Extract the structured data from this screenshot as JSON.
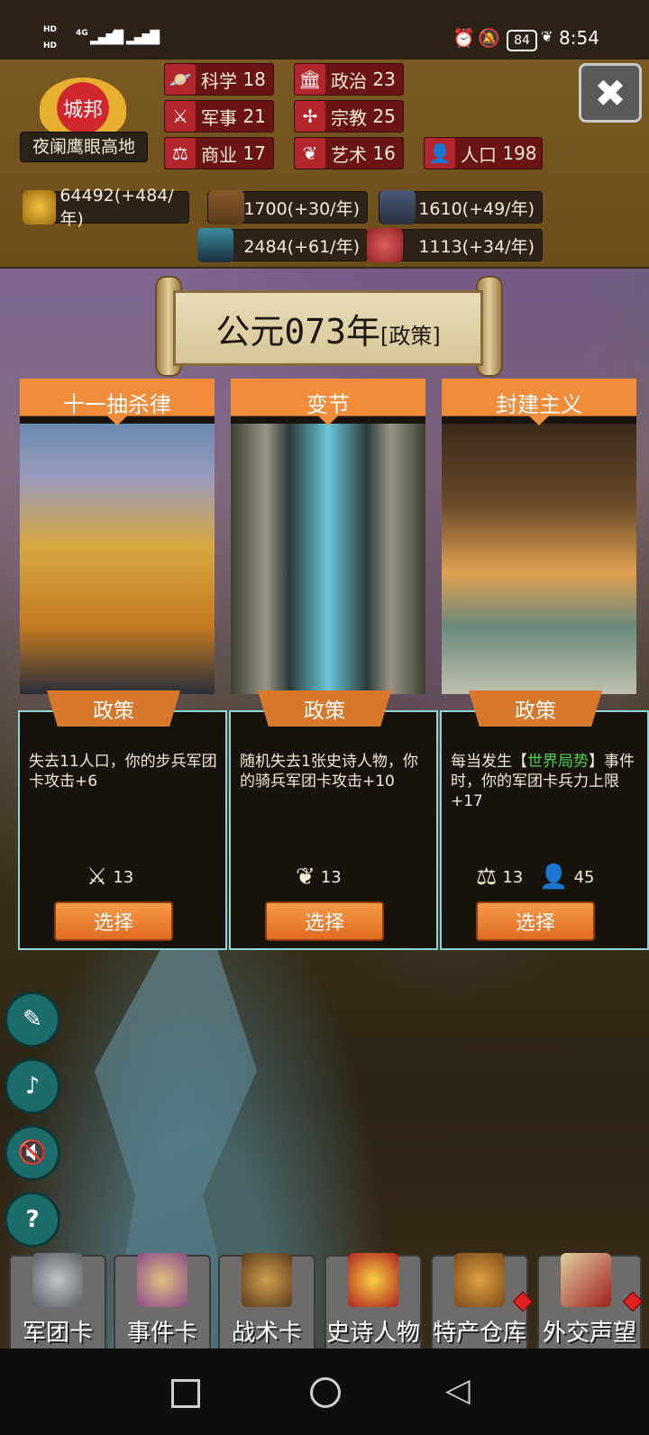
{
  "status_bar": {
    "time": "8:54",
    "battery": "84",
    "hd1": "HD",
    "hd2": "HD",
    "sig1": "4G",
    "sig2": "4G"
  },
  "city": {
    "badge": "城邦",
    "name": "夜阑鹰眼高地"
  },
  "stats": [
    {
      "icon": "science-icon",
      "label": "科学",
      "value": "18"
    },
    {
      "icon": "politics-icon",
      "label": "政治",
      "value": "23"
    },
    {
      "icon": "military-icon",
      "label": "军事",
      "value": "21"
    },
    {
      "icon": "religion-icon",
      "label": "宗教",
      "value": "25"
    },
    {
      "icon": "commerce-icon",
      "label": "商业",
      "value": "17"
    },
    {
      "icon": "art-icon",
      "label": "艺术",
      "value": "16"
    },
    {
      "icon": "population-icon",
      "label": "人口",
      "value": "198"
    }
  ],
  "resources": [
    {
      "icon": "gold-icon",
      "text": "64492(+484/年)"
    },
    {
      "icon": "wood-icon",
      "text": "1700(+30/年)"
    },
    {
      "icon": "stone-icon",
      "text": "1610(+49/年)"
    },
    {
      "icon": "iron-icon",
      "text": "2484(+61/年)"
    },
    {
      "icon": "meat-icon",
      "text": "1113(+34/年)"
    }
  ],
  "banner": {
    "year": "公元073年",
    "mode": "[政策]"
  },
  "cards": [
    {
      "title": "十一抽杀律",
      "tag": "政策",
      "desc_pre": "失去11人口，你的步兵军团卡攻击+6",
      "desc_hl": "",
      "desc_post": "",
      "costs": [
        {
          "icon": "military-icon",
          "value": "13"
        }
      ],
      "button": "选择"
    },
    {
      "title": "变节",
      "tag": "政策",
      "desc_pre": "随机失去1张史诗人物，你的骑兵军团卡攻击+10",
      "desc_hl": "",
      "desc_post": "",
      "costs": [
        {
          "icon": "art-icon",
          "value": "13"
        }
      ],
      "button": "选择"
    },
    {
      "title": "封建主义",
      "tag": "政策",
      "desc_pre": "每当发生【",
      "desc_hl": "世界局势",
      "desc_post": "】事件时，你的军团卡兵力上限+17",
      "costs": [
        {
          "icon": "commerce-icon",
          "value": "13"
        },
        {
          "icon": "population-icon",
          "value": "45"
        }
      ],
      "button": "选择"
    }
  ],
  "tabs": [
    {
      "label": "军团卡",
      "icon": "helmet-icon",
      "badge": false
    },
    {
      "label": "事件卡",
      "icon": "scroll-icon",
      "badge": false
    },
    {
      "label": "战术卡",
      "icon": "shield-icon",
      "badge": false
    },
    {
      "label": "史诗人物",
      "icon": "crown-icon",
      "badge": false
    },
    {
      "label": "特产仓库",
      "icon": "chest-icon",
      "badge": true
    },
    {
      "label": "外交声望",
      "icon": "envelope-icon",
      "badge": true
    }
  ],
  "colors": {
    "accent": "#f08c3a",
    "highlight": "#4fd14b",
    "header": "#7a5a22"
  }
}
